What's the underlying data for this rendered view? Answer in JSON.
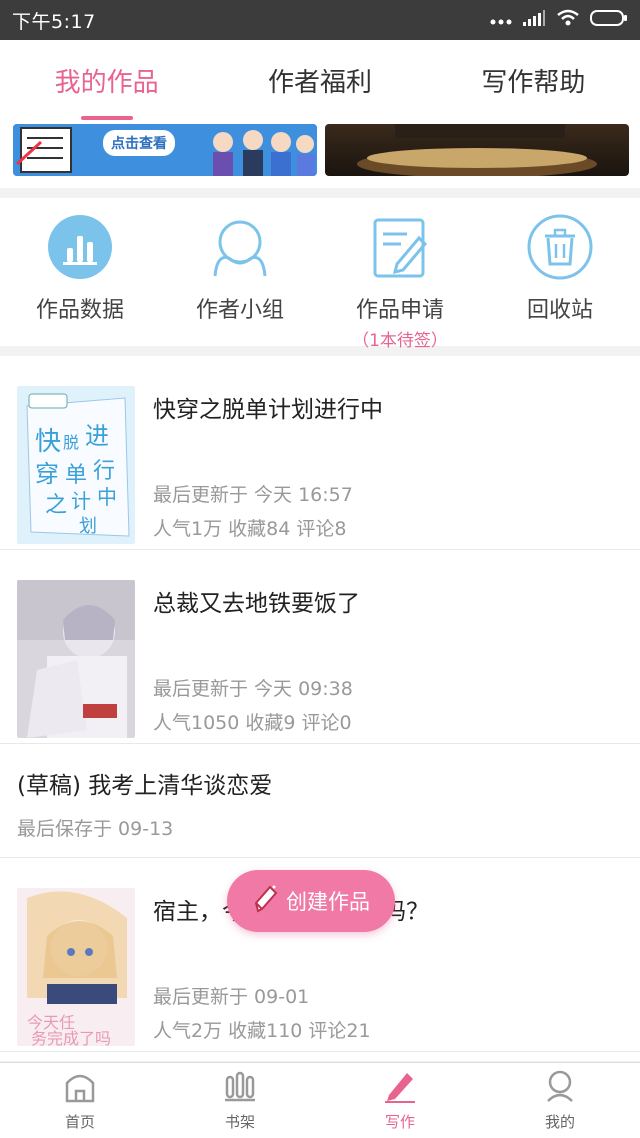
{
  "status_bar": {
    "time": "下午5:17"
  },
  "tabs": [
    {
      "label": "我的作品",
      "active": true
    },
    {
      "label": "作者福利",
      "active": false
    },
    {
      "label": "写作帮助",
      "active": false
    }
  ],
  "banners": {
    "left_button": "点击查看"
  },
  "quick_actions": [
    {
      "label": "作品数据",
      "icon": "bar-chart-icon"
    },
    {
      "label": "作者小组",
      "icon": "group-icon"
    },
    {
      "label": "作品申请",
      "sub": "（1本待签）",
      "icon": "edit-document-icon"
    },
    {
      "label": "回收站",
      "icon": "trash-icon"
    }
  ],
  "books": [
    {
      "title": "快穿之脱单计划进行中",
      "update": "最后更新于 今天 16:57",
      "stats": "人气1万 收藏84 评论8"
    },
    {
      "title": "总裁又去地铁要饭了",
      "update": "最后更新于 今天 09:38",
      "stats": "人气1050 收藏9 评论0"
    },
    {
      "title": "(草稿) 我考上清华谈恋爱",
      "update": "最后保存于 09-13"
    },
    {
      "title": "宿主，今天任务完成了吗？",
      "update": "最后更新于 09-01",
      "stats": "人气2万 收藏110 评论21"
    }
  ],
  "fab": {
    "label": "创建作品"
  },
  "bottom_nav": [
    {
      "label": "首页",
      "icon": "home-icon"
    },
    {
      "label": "书架",
      "icon": "bookshelf-icon"
    },
    {
      "label": "写作",
      "icon": "pen-icon",
      "active": true
    },
    {
      "label": "我的",
      "icon": "profile-icon"
    }
  ],
  "colors": {
    "accent": "#e8648f",
    "icon_blue": "#7cc3ec"
  }
}
